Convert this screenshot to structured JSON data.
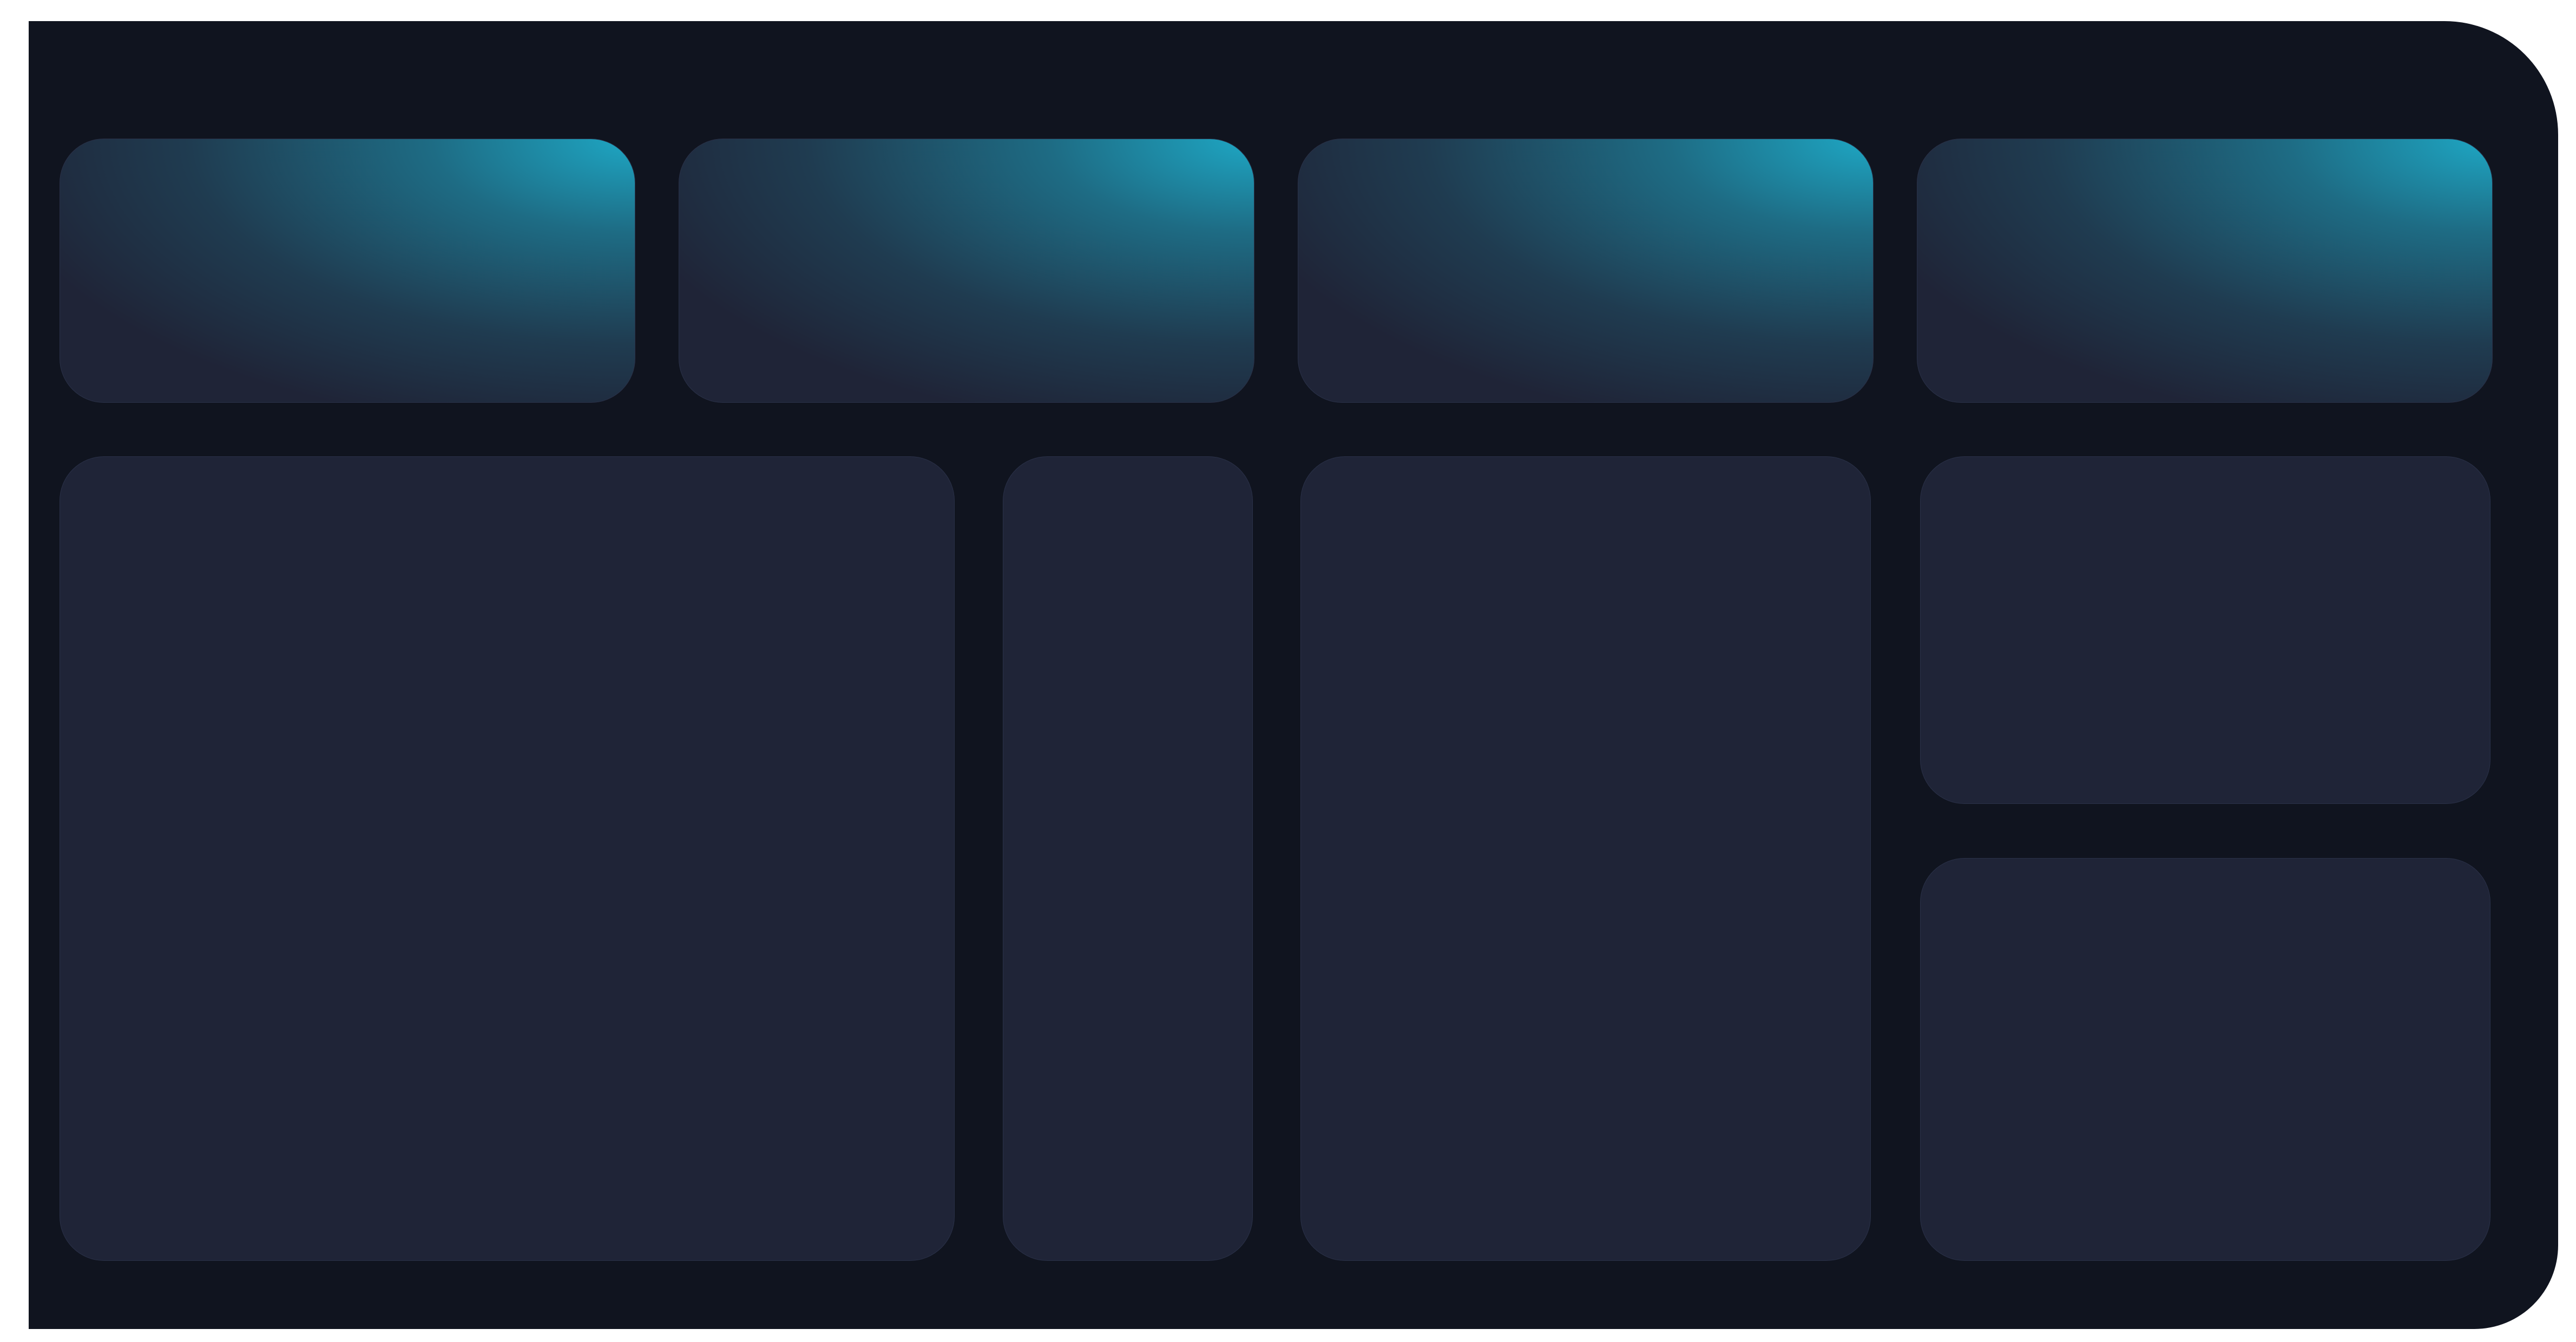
{
  "colors": {
    "background": "#10141f",
    "card": "#1f2437",
    "card_border": "#2a3148",
    "accent": "#1ea7c4"
  },
  "stat_cards": [
    {
      "id": "stat-1"
    },
    {
      "id": "stat-2"
    },
    {
      "id": "stat-3"
    },
    {
      "id": "stat-4"
    }
  ],
  "panels": [
    {
      "id": "panel-main"
    },
    {
      "id": "panel-narrow"
    },
    {
      "id": "panel-middle"
    },
    {
      "id": "panel-side-top"
    },
    {
      "id": "panel-side-bottom"
    }
  ]
}
